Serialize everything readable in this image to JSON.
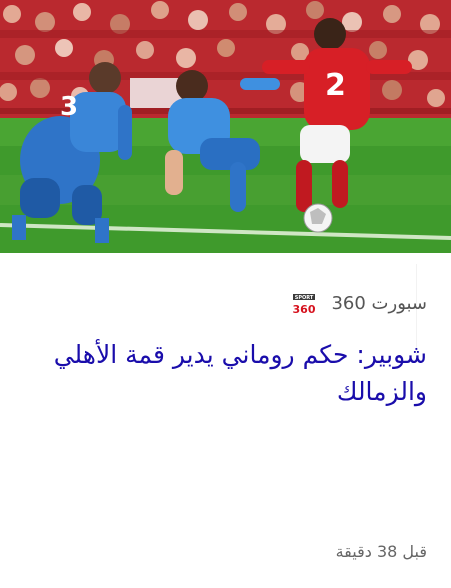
{
  "article": {
    "source_name": "سبورت 360",
    "source_logo_icon": "sport360-logo-icon",
    "headline": "شوبير: حكم روماني يدير قمة الأهلي والزمالك",
    "time_ago": "قبل 38 دقيقة",
    "image_description_icon": "football-match-photo"
  },
  "colors": {
    "headline": "#1a0dab",
    "source_text": "#555555",
    "time_text": "#666666",
    "logo_red": "#d6121e",
    "logo_grey": "#3a3a3a"
  }
}
